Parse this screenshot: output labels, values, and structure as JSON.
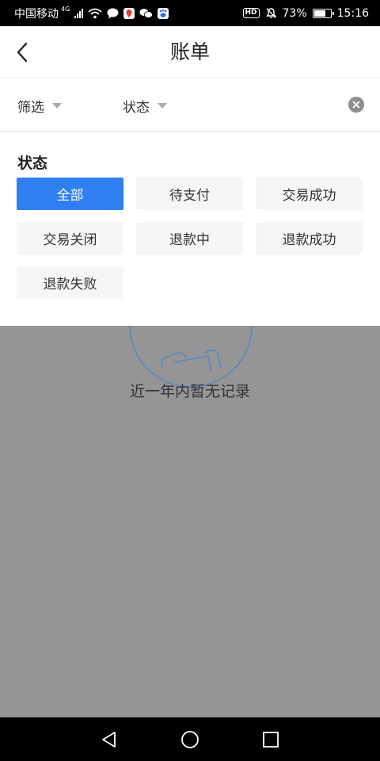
{
  "status_bar": {
    "carrier": "中国移动",
    "network": "4G",
    "hd": "HD",
    "battery_percent": "73%",
    "battery_level": 0.73,
    "time": "15:16"
  },
  "header": {
    "title": "账单"
  },
  "filter_bar": {
    "filter_label": "筛选",
    "status_label": "状态"
  },
  "panel": {
    "heading": "状态",
    "options": [
      {
        "label": "全部",
        "selected": true
      },
      {
        "label": "待支付",
        "selected": false
      },
      {
        "label": "交易成功",
        "selected": false
      },
      {
        "label": "交易关闭",
        "selected": false
      },
      {
        "label": "退款中",
        "selected": false
      },
      {
        "label": "退款成功",
        "selected": false
      },
      {
        "label": "退款失败",
        "selected": false
      }
    ]
  },
  "empty_state": {
    "message": "近一年内暂无记录"
  },
  "colors": {
    "accent": "#2f7ff0",
    "overlay": "#959597",
    "option_bg": "#f5f6f8"
  }
}
